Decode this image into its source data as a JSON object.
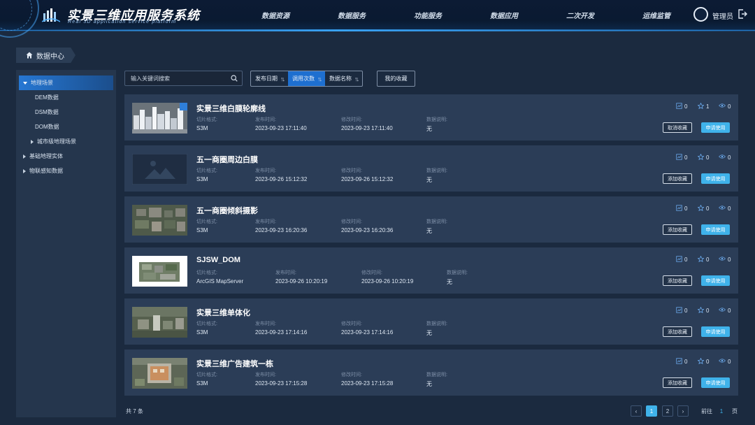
{
  "app": {
    "title_cn": "实景三维应用服务系统",
    "title_en": "Real 3D application service platform"
  },
  "nav": [
    {
      "label": "数据资源",
      "active": false
    },
    {
      "label": "数据服务",
      "active": true
    },
    {
      "label": "功能服务",
      "active": false
    },
    {
      "label": "数据应用",
      "active": false
    },
    {
      "label": "二次开发",
      "active": false
    },
    {
      "label": "运维监管",
      "active": false
    }
  ],
  "user": {
    "name": "管理员"
  },
  "breadcrumb": {
    "label": "数据中心"
  },
  "sidebar": {
    "items": [
      {
        "label": "地理场景",
        "active": true
      },
      {
        "label": "DEM数据"
      },
      {
        "label": "DSM数据"
      },
      {
        "label": "DOM数据"
      },
      {
        "label": "城市级地理场景"
      },
      {
        "label": "基础地理实体"
      },
      {
        "label": "物联感知数据"
      }
    ]
  },
  "toolbar": {
    "search_placeholder": "输入关键词搜索",
    "sort": [
      {
        "label": "发布日期"
      },
      {
        "label": "调用次数"
      },
      {
        "label": "数据名称"
      }
    ],
    "favorites_label": "我的收藏"
  },
  "labels": {
    "format": "切片格式:",
    "published": "发布时间:",
    "modified": "修改时间:",
    "description": "数据说明:",
    "apply": "申请使用",
    "add_favorite": "添加收藏",
    "cancel_favorite": "取消收藏"
  },
  "cards": [
    {
      "title": "实景三维白膜轮廓线",
      "format": "S3M",
      "published": "2023-09-23 17:11:40",
      "modified": "2023-09-23 17:11:40",
      "description": "无",
      "calls": "0",
      "stars": "1",
      "views": "0",
      "fav_label": "取消收藏"
    },
    {
      "title": "五一商圈周边白膜",
      "format": "S3M",
      "published": "2023-09-26 15:12:32",
      "modified": "2023-09-26 15:12:32",
      "description": "无",
      "calls": "0",
      "stars": "0",
      "views": "0",
      "fav_label": "添加收藏"
    },
    {
      "title": "五一商圈倾斜摄影",
      "format": "S3M",
      "published": "2023-09-23 16:20:36",
      "modified": "2023-09-23 16:20:36",
      "description": "无",
      "calls": "0",
      "stars": "0",
      "views": "0",
      "fav_label": "添加收藏"
    },
    {
      "title": "SJSW_DOM",
      "format": "ArcGIS MapServer",
      "published": "2023-09-26 10:20:19",
      "modified": "2023-09-26 10:20:19",
      "description": "无",
      "calls": "0",
      "stars": "0",
      "views": "0",
      "fav_label": "添加收藏"
    },
    {
      "title": "实景三维单体化",
      "format": "S3M",
      "published": "2023-09-23 17:14:16",
      "modified": "2023-09-23 17:14:16",
      "description": "无",
      "calls": "0",
      "stars": "0",
      "views": "0",
      "fav_label": "添加收藏"
    },
    {
      "title": "实景三维广告建筑一栋",
      "format": "S3M",
      "published": "2023-09-23 17:15:28",
      "modified": "2023-09-23 17:15:28",
      "description": "无",
      "calls": "0",
      "stars": "0",
      "views": "0",
      "fav_label": "添加收藏"
    }
  ],
  "footer": {
    "total": "共 7 条",
    "pages": [
      "1",
      "2"
    ],
    "current_page": "1",
    "goto_label": "前往",
    "goto_value": "1",
    "page_suffix": "页"
  },
  "colors": {
    "accent": "#3fb2ea",
    "active_nav": "#2a6fc7",
    "card_bg": "#2b3d57",
    "page_bg": "#1b2a3f"
  }
}
